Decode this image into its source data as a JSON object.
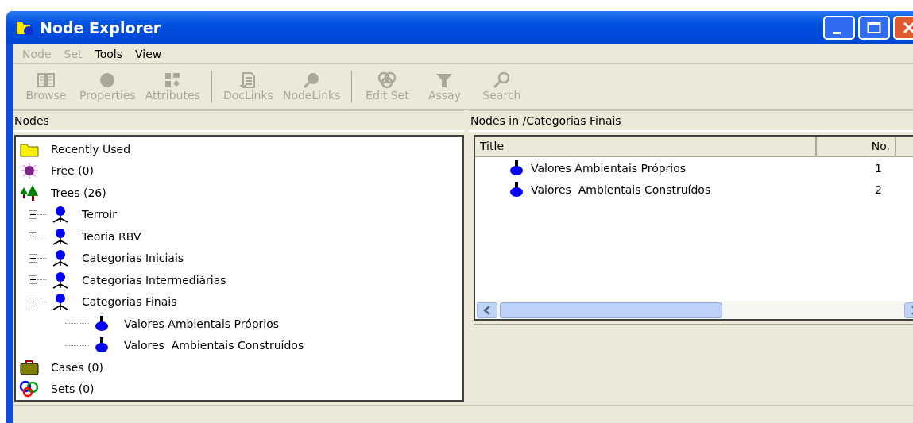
{
  "window": {
    "title": "Node Explorer"
  },
  "menu": [
    {
      "label": "Node",
      "disabled": true
    },
    {
      "label": "Set",
      "disabled": true
    },
    {
      "label": "Tools",
      "disabled": false
    },
    {
      "label": "View",
      "disabled": false
    }
  ],
  "toolbar_groups": [
    [
      {
        "label": "Browse",
        "kind": "book",
        "disabled": true
      },
      {
        "label": "Properties",
        "kind": "dot",
        "disabled": true
      },
      {
        "label": "Attributes",
        "kind": "blocks",
        "disabled": true
      }
    ],
    [
      {
        "label": "DocLinks",
        "kind": "doc",
        "disabled": true
      },
      {
        "label": "NodeLinks",
        "kind": "pin",
        "disabled": true
      }
    ],
    [
      {
        "label": "Edit Set",
        "kind": "rings",
        "disabled": true
      },
      {
        "label": "Assay",
        "kind": "funnel",
        "disabled": true
      },
      {
        "label": "Search",
        "kind": "magnifier",
        "disabled": true
      }
    ]
  ],
  "nodes_pane": {
    "title": "Nodes",
    "items": [
      {
        "label": "Recently Used",
        "kind": "folder"
      },
      {
        "label": "Free (0)",
        "kind": "free"
      },
      {
        "label": "Trees (26)",
        "kind": "trees",
        "children": [
          {
            "label": "Terroir",
            "kind": "tree",
            "expanded": false
          },
          {
            "label": "Teoria RBV",
            "kind": "tree",
            "expanded": false
          },
          {
            "label": "Categorias Iniciais",
            "kind": "tree",
            "expanded": false
          },
          {
            "label": "Categorias Intermediárias",
            "kind": "tree",
            "expanded": false
          },
          {
            "label": "Categorias Finais",
            "kind": "tree",
            "expanded": true,
            "children": [
              {
                "label": "Valores Ambientais Próprios",
                "kind": "node"
              },
              {
                "label": "Valores  Ambientais Construídos",
                "kind": "node"
              }
            ]
          }
        ]
      },
      {
        "label": "Cases (0)",
        "kind": "cases"
      },
      {
        "label": "Sets (0)",
        "kind": "sets"
      }
    ]
  },
  "list_pane": {
    "title": "Nodes in /Categorias Finais",
    "columns": [
      "Title",
      "No."
    ],
    "rows": [
      {
        "title": "Valores Ambientais Próprios",
        "no": "1"
      },
      {
        "title": "Valores  Ambientais Construídos",
        "no": "2"
      }
    ]
  }
}
